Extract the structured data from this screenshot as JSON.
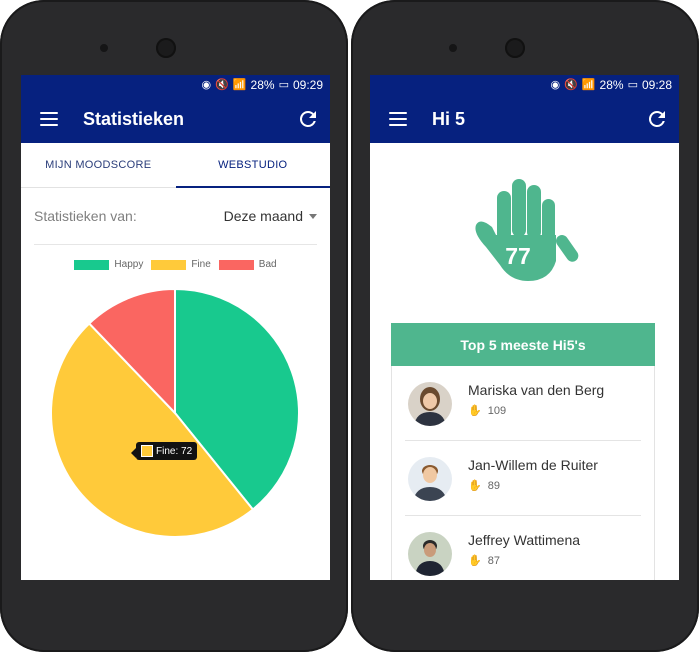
{
  "status_left": {
    "battery": "28%",
    "time": "09:29"
  },
  "status_right": {
    "battery": "28%",
    "time": "09:28"
  },
  "left_screen": {
    "title": "Statistieken",
    "tabs": [
      {
        "label": "MIJN MOODSCORE"
      },
      {
        "label": "WEBSTUDIO"
      }
    ],
    "filter": {
      "label": "Statistieken van:",
      "value": "Deze maand"
    },
    "tooltip": {
      "text": "Fine: 72"
    }
  },
  "chart_data": {
    "type": "pie",
    "legend": [
      {
        "name": "Happy",
        "color": "#18c98e"
      },
      {
        "name": "Fine",
        "color": "#ffca3a"
      },
      {
        "name": "Bad",
        "color": "#fa6661"
      }
    ],
    "values": [
      58,
      72,
      18
    ],
    "categories": [
      "Happy",
      "Fine",
      "Bad"
    ]
  },
  "right_screen": {
    "title": "Hi 5",
    "hand_count": "77",
    "top5_title": "Top 5 meeste Hi5's",
    "people": [
      {
        "name": "Mariska van den Berg",
        "count": "109"
      },
      {
        "name": "Jan-Willem de Ruiter",
        "count": "89"
      },
      {
        "name": "Jeffrey Wattimena",
        "count": "87"
      }
    ]
  },
  "icons": [
    "menu-icon",
    "refresh-icon",
    "hand-icon",
    "caret-down-icon"
  ],
  "colors": {
    "appbar": "#06217f",
    "accent": "#4fb68e"
  }
}
